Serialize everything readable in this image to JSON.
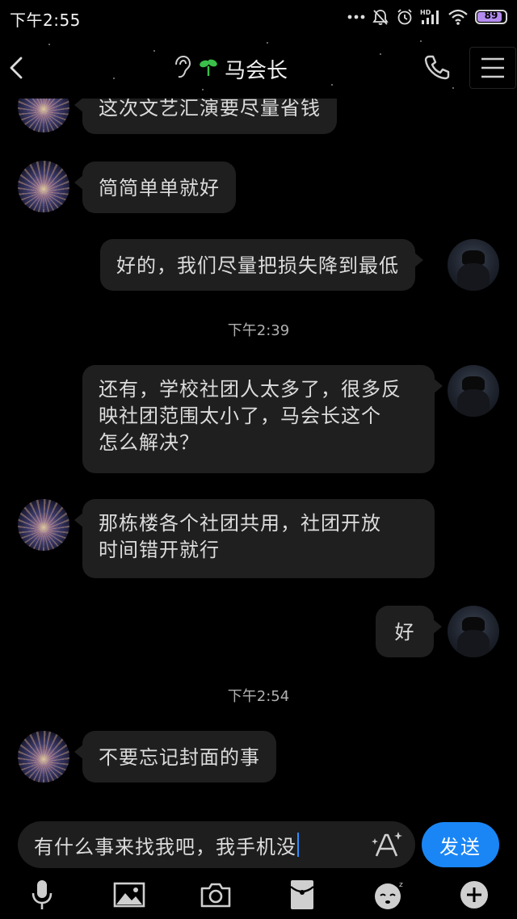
{
  "status_bar": {
    "time": "下午2:55",
    "battery": "89",
    "battery_level": 0.89,
    "network_label": "HD"
  },
  "header": {
    "title": "马会长"
  },
  "messages": [
    {
      "side": "left",
      "text": "这次文艺汇演要尽量省钱"
    },
    {
      "side": "left",
      "text": "简简单单就好"
    },
    {
      "side": "right",
      "text": "好的，我们尽量把损失降到最低"
    },
    {
      "type": "time",
      "text": "下午2:39"
    },
    {
      "side": "right",
      "lines": [
        "还有，学校社团人太多了，很多反",
        "映社团范围太小了，马会长这个",
        "怎么解决？"
      ]
    },
    {
      "side": "left",
      "lines": [
        "那栋楼各个社团共用，社团开放",
        "时间错开就行"
      ]
    },
    {
      "side": "right",
      "text": "好"
    },
    {
      "type": "time",
      "text": "下午2:54"
    },
    {
      "side": "left",
      "text": "不要忘记封面的事"
    }
  ],
  "input": {
    "value": "有什么事来找我吧，我手机没",
    "send_label": "发送"
  },
  "toolbar": {
    "items": [
      "microphone-icon",
      "image-icon",
      "camera-icon",
      "red-packet-icon",
      "emoji-icon",
      "plus-icon"
    ]
  },
  "colors": {
    "background": "#000000",
    "bubble": "#1f1f1f",
    "send_button": "#1a86f5",
    "caret": "#2f8cff",
    "sprout": "#3ac04a"
  }
}
